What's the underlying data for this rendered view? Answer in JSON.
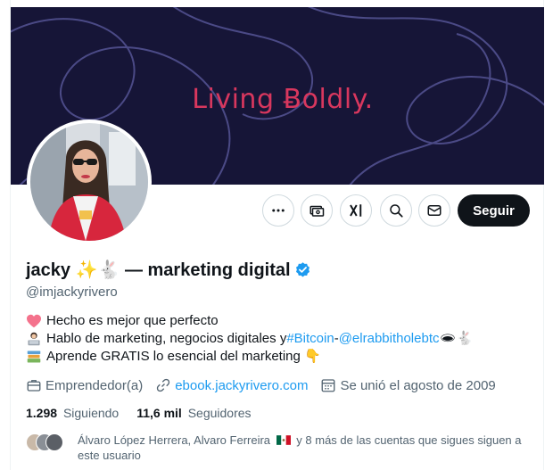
{
  "banner": {
    "text": "Living Ƀoldly."
  },
  "actions": {
    "more_icon": "more-horizontal-icon",
    "tip_icon": "money-icon",
    "grok_icon": "grok-icon",
    "search_icon": "search-icon",
    "message_icon": "envelope-icon",
    "follow_label": "Seguir"
  },
  "profile": {
    "display_name": "jacky ✨🐇 — marketing digital",
    "handle": "@imjackyrivero",
    "verified": true
  },
  "bio": {
    "line1": "Hecho es mejor que perfecto",
    "line2_prefix": "Hablo de marketing, negocios digitales y ",
    "line2_hashtag": "#Bitcoin",
    "line2_sep": " -",
    "line2_mention": "@elrabbitholebtc",
    "line2_suffix": " 🕳🐇",
    "line3": "Aprende GRATIS lo esencial del marketing 👇"
  },
  "meta": {
    "category": "Emprendedor(a)",
    "website": "ebook.jackyrivero.com",
    "joined": "Se unió el agosto de 2009"
  },
  "stats": {
    "following_count": "1.298",
    "following_label": "Siguiendo",
    "followers_count": "11,6 mil",
    "followers_label": "Seguidores"
  },
  "known_followers": {
    "text_before_flag": "Álvaro López Herrera, Alvaro Ferreira",
    "text_after_flag": "y 8 más de las cuentas que sigues siguen a este usuario"
  },
  "colors": {
    "banner_bg": "#161537",
    "banner_text": "#d8375e",
    "link": "#1d9bf0",
    "secondary_text": "#536471",
    "primary_text": "#0f1419",
    "follow_button": "#0f1419"
  }
}
